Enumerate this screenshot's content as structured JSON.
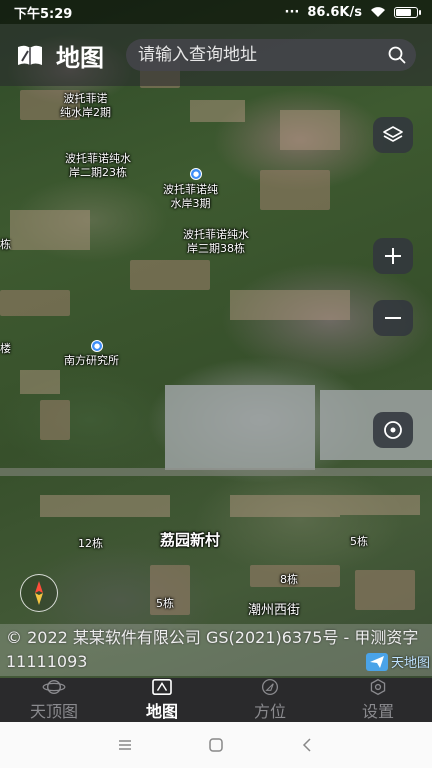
{
  "status_bar": {
    "time": "下午5:29",
    "dots": "···",
    "network_speed": "86.6K/s"
  },
  "header": {
    "title": "地图",
    "search_placeholder": "请输入查询地址"
  },
  "map": {
    "labels": {
      "l1": "波托菲诺",
      "l1b": "纯水岸2期",
      "l2": "波托菲诺纯水",
      "l2b": "岸二期23栋",
      "l3": "波托菲诺纯",
      "l3b": "水岸3期",
      "l4": "波托菲诺纯水",
      "l4b": "岸三期38栋",
      "l5": "南方研究所",
      "l6": "荔园新村",
      "l7": "12栋",
      "l8": "5栋",
      "l9": "8栋",
      "l10": "5栋",
      "l11": "潮州西街",
      "edge_left1": "栋",
      "edge_left2": "楼"
    }
  },
  "controls": {
    "layers_icon": "layers-icon",
    "zoom_in_icon": "plus-icon",
    "zoom_out_icon": "minus-icon",
    "locate_icon": "locate-icon",
    "compass_icon": "compass-icon"
  },
  "copyright": {
    "text": "© 2022 某某软件有限公司 GS(2021)6375号 - 甲测资字11111093",
    "badge": "天地图"
  },
  "bottom_nav": {
    "items": [
      {
        "label": "天顶图",
        "icon": "planet-icon"
      },
      {
        "label": "地图",
        "icon": "map-icon"
      },
      {
        "label": "方位",
        "icon": "direction-icon"
      },
      {
        "label": "设置",
        "icon": "settings-icon"
      }
    ],
    "active_index": 1
  },
  "colors": {
    "accent_blue": "#3e8ef7",
    "nav_bg": "#2a2a2c",
    "control_bg": "#32373e"
  }
}
